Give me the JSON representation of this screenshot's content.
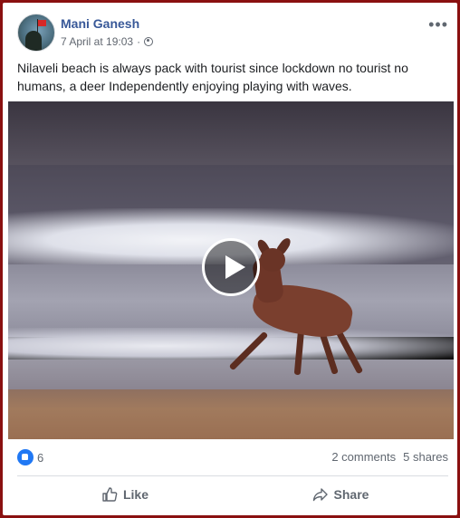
{
  "post": {
    "author": "Mani Ganesh",
    "timestamp": "7 April at 19:03",
    "separator": "·",
    "privacy_icon": "globe-icon",
    "more_icon": "ellipsis-icon",
    "more_glyph": "•••",
    "text": "Nilaveli beach is always pack with tourist since lockdown no tourist no humans, a deer Independently enjoying playing with waves."
  },
  "media": {
    "type": "video",
    "play_icon": "play-icon"
  },
  "stats": {
    "reaction_icon": "like-reaction-icon",
    "reaction_count": "6",
    "comments": "2 comments",
    "shares": "5 shares"
  },
  "actions": {
    "like_label": "Like",
    "share_label": "Share"
  },
  "colors": {
    "author_link": "#385898",
    "like_blue": "#2078f4",
    "muted_text": "#606770",
    "frame": "#8a1010"
  }
}
